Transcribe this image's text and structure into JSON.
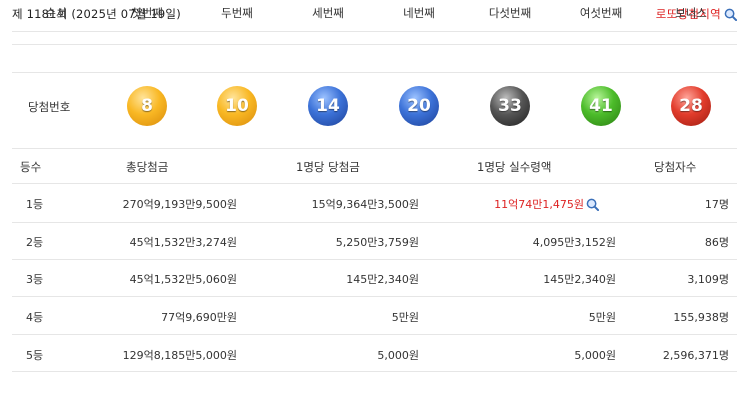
{
  "header": {
    "draw_title": "제 1181회 (2025년 07월 19일)",
    "link_label": "로또당첨지역",
    "link_icon": "magnifier-icon"
  },
  "balls": {
    "headers": [
      "순서",
      "첫번째",
      "두번째",
      "세번째",
      "네번째",
      "다섯번째",
      "여섯번째",
      "보너스"
    ],
    "row_label": "당첨번호",
    "numbers": [
      {
        "value": "8",
        "color": "yellow"
      },
      {
        "value": "10",
        "color": "yellow"
      },
      {
        "value": "14",
        "color": "blue"
      },
      {
        "value": "20",
        "color": "blue"
      },
      {
        "value": "33",
        "color": "black"
      },
      {
        "value": "41",
        "color": "green"
      },
      {
        "value": "28",
        "color": "red"
      }
    ]
  },
  "prizes": {
    "headers": [
      "등수",
      "총당첨금",
      "1명당 당첨금",
      "1명당 실수령액",
      "당첨자수"
    ],
    "rows": [
      {
        "rank": "1등",
        "total": "270억9,193만9,500원",
        "per_person": "15억9,364만3,500원",
        "net": "11억74만1,475원",
        "winners": "17명"
      },
      {
        "rank": "2등",
        "total": "45억1,532만3,274원",
        "per_person": "5,250만3,759원",
        "net": "4,095만3,152원",
        "winners": "86명"
      },
      {
        "rank": "3등",
        "total": "45억1,532만5,060원",
        "per_person": "145만2,340원",
        "net": "145만2,340원",
        "winners": "3,109명"
      },
      {
        "rank": "4등",
        "total": "77억9,690만원",
        "per_person": "5만원",
        "net": "5만원",
        "winners": "155,938명"
      },
      {
        "rank": "5등",
        "total": "129억8,185만5,000원",
        "per_person": "5,000원",
        "net": "5,000원",
        "winners": "2,596,371명"
      }
    ]
  },
  "colors": {
    "accent_red": "#dd2222",
    "divider": "#e6e6e6"
  }
}
